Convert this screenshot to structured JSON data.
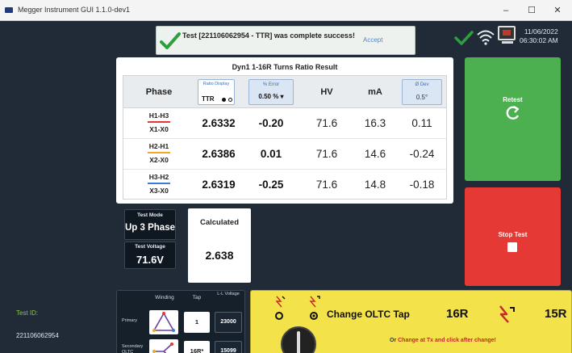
{
  "window": {
    "title": "Megger Instrument GUI 1.1.0-dev1",
    "minimize": "–",
    "maximize": "☐",
    "close": "✕"
  },
  "notification": {
    "message": "Test [221106062954 - TTR] was complete success!",
    "accept_label": "Accept"
  },
  "status": {
    "date": "11/06/2022",
    "time": "06:30:02 AM"
  },
  "results": {
    "title": "Dyn1 1-16R Turns Ratio Result",
    "headers": {
      "phase": "Phase",
      "ratio_caption": "Ratio Display",
      "ratio_value": "TTR",
      "error_caption": "% Error",
      "error_value": "0.50 %",
      "hv": "HV",
      "ma": "mA",
      "dev_caption": "Ø Dev",
      "dev_value": "0.5°"
    },
    "rows": [
      {
        "phase_top": "H1-H3",
        "phase_bottom": "X1-X0",
        "line_color": "#e53935",
        "ratio": "2.6332",
        "error": "-0.20",
        "hv": "71.6",
        "ma": "16.3",
        "dev": "0.11"
      },
      {
        "phase_top": "H2-H1",
        "phase_bottom": "X2-X0",
        "line_color": "#f5a623",
        "ratio": "2.6386",
        "error": "0.01",
        "hv": "71.6",
        "ma": "14.6",
        "dev": "-0.24"
      },
      {
        "phase_top": "H3-H2",
        "phase_bottom": "X3-X0",
        "line_color": "#3a7bd5",
        "ratio": "2.6319",
        "error": "-0.25",
        "hv": "71.6",
        "ma": "14.8",
        "dev": "-0.18"
      }
    ]
  },
  "test_mode": {
    "caption": "Test Mode",
    "value": "Up 3 Phase"
  },
  "test_voltage": {
    "caption": "Test Voltage",
    "value": "71.6V"
  },
  "calculated": {
    "caption": "Calculated",
    "value": "2.638"
  },
  "buttons": {
    "retest": "Retest",
    "stop": "Stop Test"
  },
  "test_id": {
    "caption": "Test ID:",
    "value": "221106062954"
  },
  "winding": {
    "headers": {
      "winding": "Winding",
      "tap": "Tap",
      "ll_voltage": "L-L Voltage"
    },
    "primary": {
      "label": "Primary",
      "tap": "1",
      "voltage": "23000"
    },
    "secondary": {
      "label": "Secondary OLTC",
      "tap": "16R*",
      "voltage": "15099"
    }
  },
  "oltc": {
    "title": "Change OLTC Tap",
    "from_tap": "16R",
    "to_tap": "15R",
    "instruction_or": "Or",
    "instruction": "Change at Tx and click after change!"
  },
  "colors": {
    "retest": "#4caf50",
    "stop": "#e53935",
    "oltc_panel": "#f3e24a",
    "success": "#2e9e3e"
  }
}
